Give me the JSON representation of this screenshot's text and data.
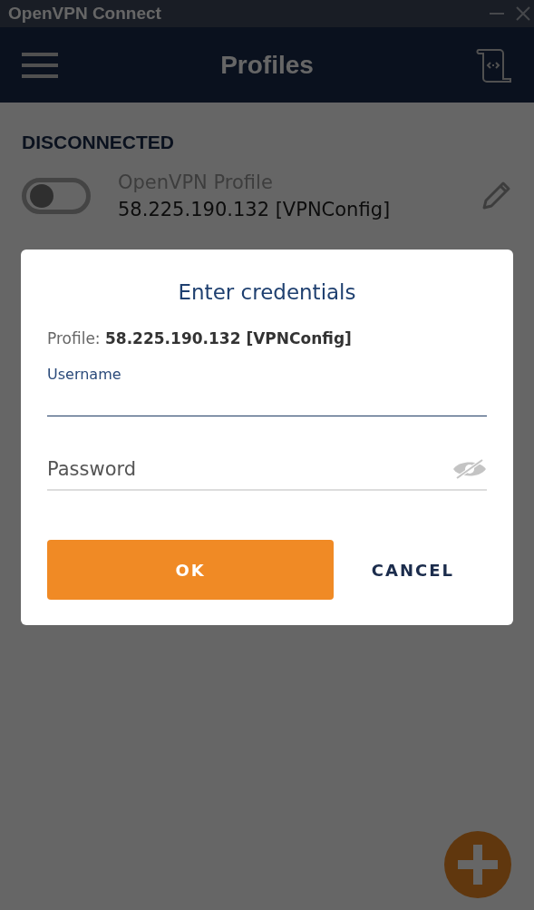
{
  "window": {
    "title": "OpenVPN Connect"
  },
  "header": {
    "title": "Profiles"
  },
  "status": "DISCONNECTED",
  "profiles": [
    {
      "name": "OpenVPN Profile",
      "address": "58.225.190.132 [VPNConfig]",
      "on": false
    }
  ],
  "dialog": {
    "title": "Enter credentials",
    "profile_label": "Profile:",
    "profile_value": "58.225.190.132 [VPNConfig]",
    "username": {
      "label": "Username"
    },
    "password": {
      "placeholder": "Password",
      "visible": false
    },
    "buttons": [
      {
        "label": "OK",
        "kind": "primary"
      },
      {
        "label": "CANCEL",
        "kind": "text"
      }
    ]
  }
}
